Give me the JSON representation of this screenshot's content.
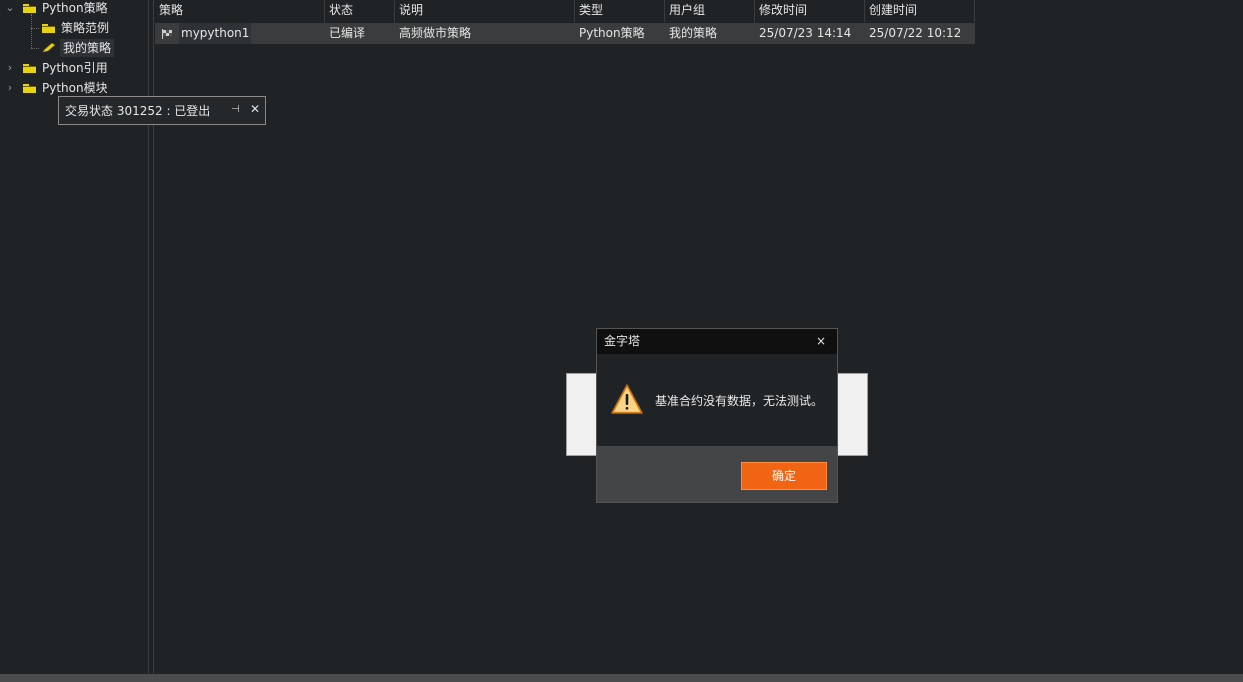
{
  "tree": {
    "nodes": [
      {
        "label": "Python策略"
      },
      {
        "label": "策略范例"
      },
      {
        "label": "我的策略"
      },
      {
        "label": "Python引用"
      },
      {
        "label": "Python模块"
      }
    ]
  },
  "tooltip": {
    "text": "交易状态 301252 : 已登出"
  },
  "table": {
    "columns": [
      "策略",
      "状态",
      "说明",
      "类型",
      "用户组",
      "修改时间",
      "创建时间"
    ],
    "rows": [
      {
        "name": "mypython1",
        "status": "已编译",
        "description": "高频做市策略",
        "type": "Python策略",
        "group": "我的策略",
        "modified": "25/07/23 14:14",
        "created": "25/07/22 10:12"
      }
    ]
  },
  "dialog": {
    "title": "金字塔",
    "close": "×",
    "message": "基准合约没有数据，无法测试。",
    "ok_label": "确定"
  },
  "colors": {
    "background": "#202326",
    "accent": "#f06414",
    "folder": "#e8d40e"
  }
}
